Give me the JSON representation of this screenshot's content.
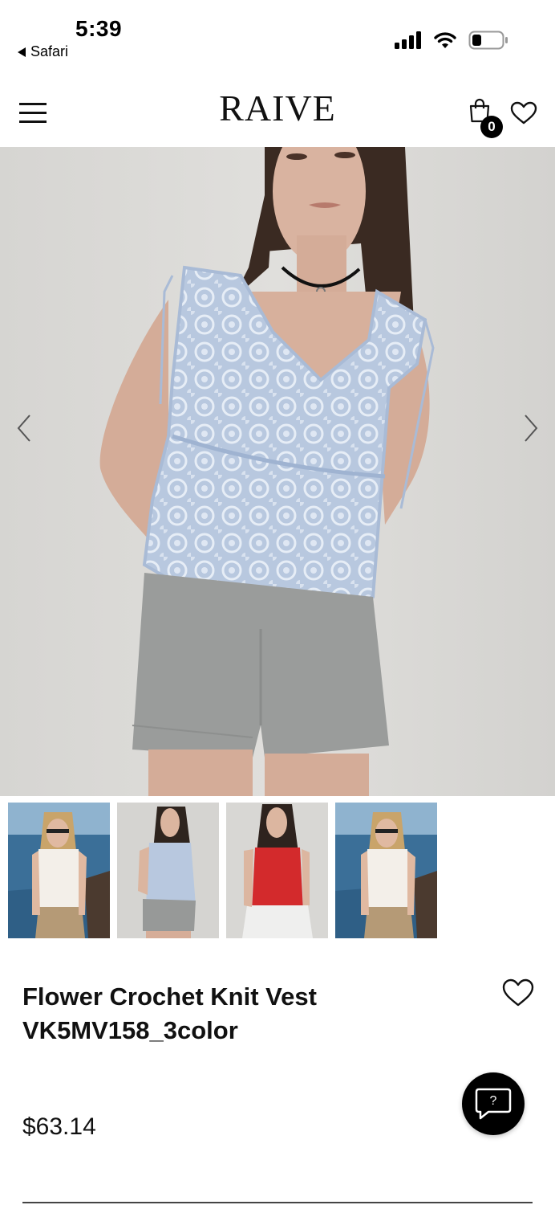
{
  "status_bar": {
    "time": "5:39",
    "back_app_label": "Safari",
    "signal_icon": "cellular-signal-icon",
    "wifi_icon": "wifi-icon",
    "battery_icon": "battery-icon"
  },
  "header": {
    "brand": "RAIVE",
    "menu_icon": "hamburger-menu-icon",
    "cart_icon": "shopping-bag-icon",
    "cart_count": "0",
    "wishlist_icon": "heart-icon"
  },
  "gallery": {
    "prev_icon": "chevron-left-icon",
    "next_icon": "chevron-right-icon",
    "thumbnails": [
      {
        "color": "white",
        "scene": "beach"
      },
      {
        "color": "blue",
        "scene": "studio"
      },
      {
        "color": "red",
        "scene": "studio"
      },
      {
        "color": "white",
        "scene": "beach"
      }
    ]
  },
  "product": {
    "title_line1": "Flower Crochet Knit Vest",
    "title_line2": "VK5MV158_3color",
    "price": "$63.14",
    "wishlist_icon": "heart-icon"
  },
  "chat": {
    "label": "?",
    "icon": "chat-bubble-icon"
  },
  "colors": {
    "background": "#ffffff",
    "text": "#111111",
    "badge": "#000000",
    "hero_bg": "#dad9d6",
    "vest_blue": "#b9c9e0",
    "vest_red": "#d32a2c",
    "shorts_gray": "#9a9c9b"
  }
}
